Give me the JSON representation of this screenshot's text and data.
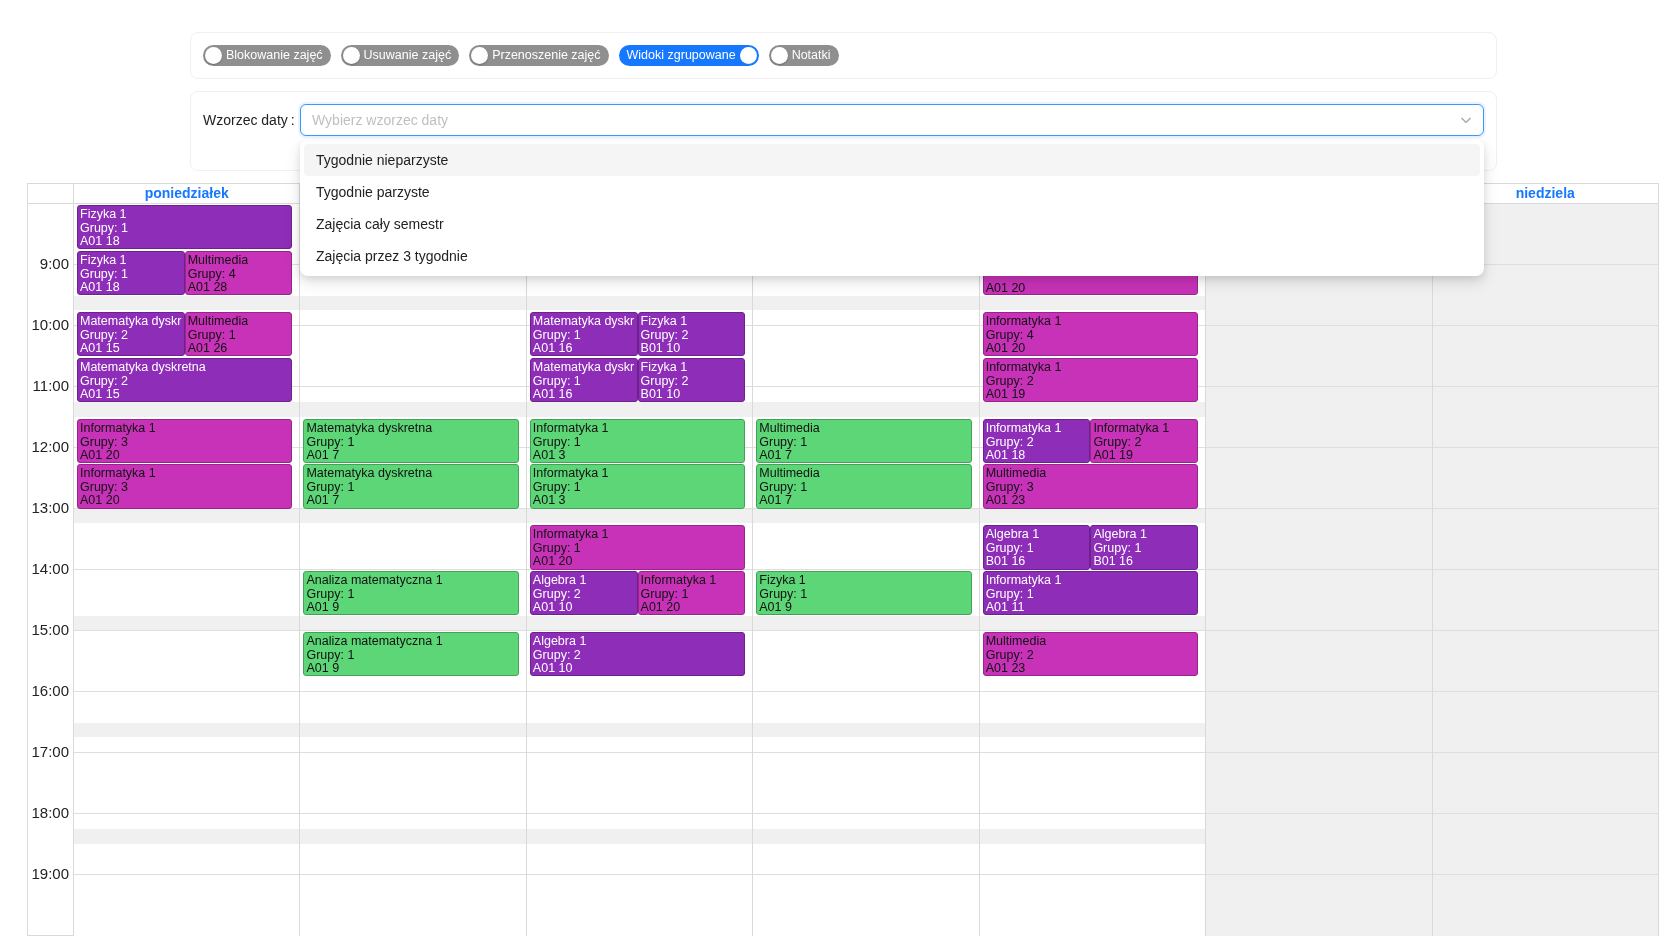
{
  "toggles": [
    {
      "label": "Blokowanie zajęć",
      "on": false
    },
    {
      "label": "Usuwanie zajęć",
      "on": false
    },
    {
      "label": "Przenoszenie zajęć",
      "on": false
    },
    {
      "label": "Widoki zgrupowane",
      "on": true
    },
    {
      "label": "Notatki",
      "on": false
    }
  ],
  "date_pattern": {
    "label": "Wzorzec daty",
    "label_suffix": ":",
    "placeholder": "Wybierz wzorzec daty",
    "expanded": true,
    "options": [
      {
        "label": "Tygodnie nieparzyste",
        "highlighted": true
      },
      {
        "label": "Tygodnie parzyste",
        "highlighted": false
      },
      {
        "label": "Zajęcia cały semestr",
        "highlighted": false
      },
      {
        "label": "Zajęcia przez 3 tygodnie",
        "highlighted": false
      }
    ]
  },
  "calendar": {
    "hours": [
      "9:00",
      "10:00",
      "11:00",
      "12:00",
      "13:00",
      "14:00",
      "15:00",
      "16:00",
      "17:00",
      "18:00",
      "19:00"
    ],
    "days": [
      {
        "header": "poniedziałek",
        "disabled": false,
        "periods": [
          {
            "kind": "classes",
            "events": [
              {
                "color": "#8e2db8",
                "title": "Fizyka 1",
                "groups": "Grupy: 1",
                "room": "A01 18"
              }
            ]
          },
          {
            "kind": "classes",
            "events": [
              {
                "color": "#8e2db8",
                "title": "Fizyka 1",
                "groups": "Grupy: 1",
                "room": "A01 18"
              },
              {
                "color": "#c832b8",
                "title": "Multimedia",
                "groups": "Grupy: 4",
                "room": "A01 28"
              }
            ]
          },
          {
            "kind": "classes",
            "events": [
              {
                "color": "#8e2db8",
                "title": "Matematyka dyskr",
                "groups": "Grupy: 2",
                "room": "A01 15"
              },
              {
                "color": "#c832b8",
                "title": "Multimedia",
                "groups": "Grupy: 1",
                "room": "A01 26"
              }
            ]
          },
          {
            "kind": "classes",
            "events": [
              {
                "color": "#8e2db8",
                "title": "Matematyka dyskretna",
                "groups": "Grupy: 2",
                "room": "A01 15"
              }
            ]
          },
          {
            "kind": "classes",
            "events": [
              {
                "color": "#c832b8",
                "title": "Informatyka 1",
                "groups": "Grupy: 3",
                "room": "A01 20"
              }
            ]
          },
          {
            "kind": "classes",
            "events": [
              {
                "color": "#c832b8",
                "title": "Informatyka 1",
                "groups": "Grupy: 3",
                "room": "A01 20"
              }
            ]
          }
        ]
      },
      {
        "disabled": false,
        "periods": [
          {
            "kind": "free"
          },
          {
            "kind": "free"
          },
          {
            "kind": "free"
          },
          {
            "kind": "free"
          },
          {
            "kind": "classes",
            "events": [
              {
                "color": "#5cd677",
                "title": "Matematyka dyskretna",
                "groups": "Grupy: 1",
                "room": "A01 7"
              }
            ]
          },
          {
            "kind": "classes",
            "events": [
              {
                "color": "#5cd677",
                "title": "Matematyka dyskretna",
                "groups": "Grupy: 1",
                "room": "A01 7"
              }
            ]
          },
          {
            "kind": "free"
          },
          {
            "kind": "classes",
            "events": [
              {
                "color": "#5cd677",
                "title": "Analiza matematyczna 1",
                "groups": "Grupy: 1",
                "room": "A01 9"
              }
            ]
          },
          {
            "kind": "classes",
            "events": [
              {
                "color": "#5cd677",
                "title": "Analiza matematyczna 1",
                "groups": "Grupy: 1",
                "room": "A01 9"
              }
            ]
          }
        ]
      },
      {
        "disabled": false,
        "periods": [
          {
            "kind": "free"
          },
          {
            "kind": "free"
          },
          {
            "kind": "classes",
            "events": [
              {
                "color": "#8e2db8",
                "title": "Matematyka dyskr",
                "groups": "Grupy: 1",
                "room": "A01 16"
              },
              {
                "color": "#8e2db8",
                "title": "Fizyka 1",
                "groups": "Grupy: 2",
                "room": "B01 10"
              }
            ]
          },
          {
            "kind": "classes",
            "events": [
              {
                "color": "#8e2db8",
                "title": "Matematyka dyskr",
                "groups": "Grupy: 1",
                "room": "A01 16"
              },
              {
                "color": "#8e2db8",
                "title": "Fizyka 1",
                "groups": "Grupy: 2",
                "room": "B01 10"
              }
            ]
          },
          {
            "kind": "classes",
            "events": [
              {
                "color": "#5cd677",
                "title": "Informatyka 1",
                "groups": "Grupy: 1",
                "room": "A01 3"
              }
            ]
          },
          {
            "kind": "classes",
            "events": [
              {
                "color": "#5cd677",
                "title": "Informatyka 1",
                "groups": "Grupy: 1",
                "room": "A01 3"
              }
            ]
          },
          {
            "kind": "classes",
            "events": [
              {
                "color": "#c832b8",
                "title": "Informatyka 1",
                "groups": "Grupy: 1",
                "room": "A01 20"
              }
            ]
          },
          {
            "kind": "classes",
            "events": [
              {
                "color": "#8e2db8",
                "title": "Algebra 1",
                "groups": "Grupy: 2",
                "room": "A01 10"
              },
              {
                "color": "#c832b8",
                "title": "Informatyka 1",
                "groups": "Grupy: 1",
                "room": "A01 20"
              }
            ]
          },
          {
            "kind": "classes",
            "events": [
              {
                "color": "#8e2db8",
                "title": "Algebra 1",
                "groups": "Grupy: 2",
                "room": "A01 10"
              }
            ]
          }
        ]
      },
      {
        "disabled": false,
        "periods": [
          {
            "kind": "free"
          },
          {
            "kind": "free"
          },
          {
            "kind": "free"
          },
          {
            "kind": "free"
          },
          {
            "kind": "classes",
            "events": [
              {
                "color": "#5cd677",
                "title": "Multimedia",
                "groups": "Grupy: 1",
                "room": "A01 7"
              }
            ]
          },
          {
            "kind": "classes",
            "events": [
              {
                "color": "#5cd677",
                "title": "Multimedia",
                "groups": "Grupy: 1",
                "room": "A01 7"
              }
            ]
          },
          {
            "kind": "free"
          },
          {
            "kind": "classes",
            "events": [
              {
                "color": "#5cd677",
                "title": "Fizyka 1",
                "groups": "Grupy: 1",
                "room": "A01 9"
              }
            ]
          }
        ]
      },
      {
        "disabled": false,
        "periods": [
          {
            "kind": "free"
          },
          {
            "kind": "classes",
            "events": [
              {
                "color": "#c832b8",
                "room": "A01 20"
              }
            ]
          },
          {
            "kind": "classes",
            "events": [
              {
                "color": "#c832b8",
                "title": "Informatyka 1",
                "groups": "Grupy: 4",
                "room": "A01 20"
              }
            ]
          },
          {
            "kind": "classes",
            "events": [
              {
                "color": "#c832b8",
                "title": "Informatyka 1",
                "groups": "Grupy: 2",
                "room": "A01 19"
              }
            ]
          },
          {
            "kind": "classes",
            "events": [
              {
                "color": "#8e2db8",
                "title": "Informatyka 1",
                "groups": "Grupy: 2",
                "room": "A01 18"
              },
              {
                "color": "#c832b8",
                "title": "Informatyka 1",
                "groups": "Grupy: 2",
                "room": "A01 19"
              }
            ]
          },
          {
            "kind": "classes",
            "events": [
              {
                "color": "#c832b8",
                "title": "Multimedia",
                "groups": "Grupy: 3",
                "room": "A01 23"
              }
            ]
          },
          {
            "kind": "classes",
            "events": [
              {
                "color": "#8e2db8",
                "title": "Algebra 1",
                "groups": "Grupy: 1",
                "room": "B01 16"
              },
              {
                "color": "#8e2db8",
                "title": "Algebra 1",
                "groups": "Grupy: 1",
                "room": "B01 16"
              }
            ]
          },
          {
            "kind": "classes",
            "events": [
              {
                "color": "#8e2db8",
                "title": "Informatyka 1",
                "groups": "Grupy: 1",
                "room": "A01 11"
              }
            ]
          },
          {
            "kind": "classes",
            "events": [
              {
                "color": "#c832b8",
                "title": "Multimedia",
                "groups": "Grupy: 2",
                "room": "A01 23"
              }
            ]
          }
        ]
      },
      {
        "disabled": true
      },
      {
        "header": "niedziela",
        "disabled": true
      }
    ]
  }
}
